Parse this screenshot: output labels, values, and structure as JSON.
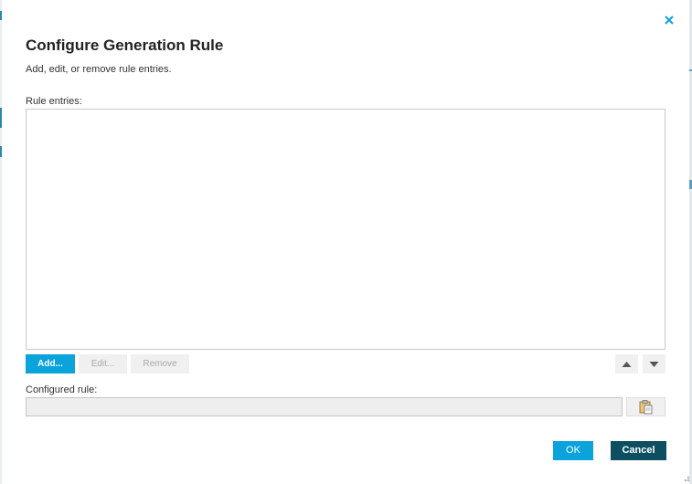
{
  "dialog": {
    "title": "Configure Generation Rule",
    "subtitle": "Add, edit, or remove rule entries.",
    "close_icon": "close-icon"
  },
  "entries": {
    "label": "Rule entries:",
    "items": []
  },
  "actions": {
    "add_label": "Add...",
    "edit_label": "Edit...",
    "remove_label": "Remove",
    "move_up_icon": "triangle-up-icon",
    "move_down_icon": "triangle-down-icon"
  },
  "configured_rule": {
    "label": "Configured rule:",
    "value": "",
    "paste_icon": "clipboard-paste-icon"
  },
  "footer": {
    "ok_label": "OK",
    "cancel_label": "Cancel"
  },
  "colors": {
    "accent": "#0aa3dc",
    "cancel": "#0d4f60",
    "disabled_text": "#a8a8a8"
  }
}
